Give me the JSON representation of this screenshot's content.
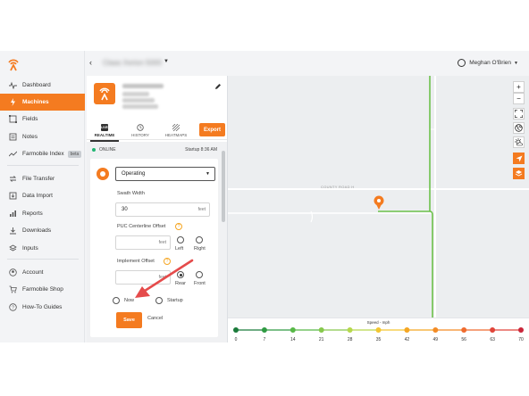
{
  "colors": {
    "accent": "#f47b20",
    "online": "#22b573",
    "path": "#6cc24a"
  },
  "sidebar": {
    "items": [
      {
        "label": "Dashboard",
        "icon": "activity-icon"
      },
      {
        "label": "Machines",
        "icon": "lightning-icon",
        "active": true
      },
      {
        "label": "Fields",
        "icon": "fields-icon"
      },
      {
        "label": "Notes",
        "icon": "note-icon"
      },
      {
        "label": "Farmobile Index",
        "icon": "trend-icon",
        "badge": "beta"
      },
      {
        "label": "File Transfer",
        "icon": "transfer-icon"
      },
      {
        "label": "Data Import",
        "icon": "import-icon"
      },
      {
        "label": "Reports",
        "icon": "reports-icon"
      },
      {
        "label": "Downloads",
        "icon": "download-icon"
      },
      {
        "label": "Inputs",
        "icon": "inputs-icon"
      },
      {
        "label": "Account",
        "icon": "account-icon"
      },
      {
        "label": "Farmobile Shop",
        "icon": "cart-icon"
      },
      {
        "label": "How-To Guides",
        "icon": "help-icon"
      }
    ]
  },
  "header": {
    "machine_title": "Claas Xerion 5000",
    "user_name": "Meghan O'Brien"
  },
  "panel": {
    "tabs": [
      {
        "label": "REALTIME",
        "badge": "LIVE"
      },
      {
        "label": "HISTORY"
      },
      {
        "label": "HEATMAPS"
      }
    ],
    "export_label": "Export",
    "status": "ONLINE",
    "status_time": "Startup 8:36 AM",
    "operation": "Operating",
    "swath_label": "Swath Width",
    "swath_value": "30",
    "swath_unit": "feet",
    "puc_label": "PUC Centerline Offset",
    "puc_unit": "feet",
    "left_label": "Left",
    "right_label": "Right",
    "implement_label": "Implement Offset",
    "implement_unit": "feet",
    "rear_label": "Rear",
    "front_label": "Front",
    "now_label": "Now",
    "startup_label": "Startup",
    "save_label": "Save",
    "cancel_label": "Cancel"
  },
  "map": {
    "road_label": "COUNTY ROAD H",
    "zoom_in": "+",
    "zoom_out": "−"
  },
  "speed": {
    "title": "Speed - mph",
    "ticks": [
      "0",
      "7",
      "14",
      "21",
      "28",
      "35",
      "42",
      "49",
      "56",
      "63",
      "70"
    ],
    "colors": [
      "#1b7a3a",
      "#2f9a42",
      "#57b847",
      "#86c84c",
      "#b6d84c",
      "#f3c531",
      "#f5a623",
      "#f38b25",
      "#ef6b2e",
      "#e0453a",
      "#c9263a"
    ]
  }
}
